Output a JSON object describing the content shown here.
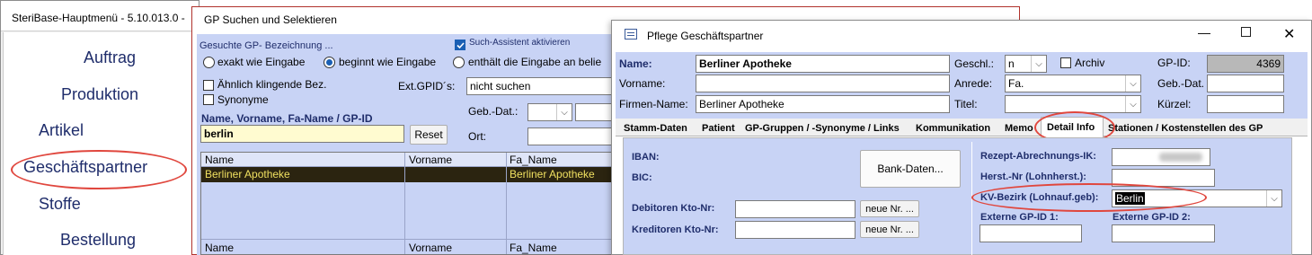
{
  "main_menu": {
    "title": "SteriBase-Hauptmenü  -  5.10.013.0  -",
    "items": [
      "Auftrag",
      "Produktion",
      "Artikel",
      "Geschäftspartner",
      "Stoffe",
      "Bestellung"
    ]
  },
  "search": {
    "title": "GP Suchen und Selektieren",
    "gesuchte_label": "Gesuchte GP- Bezeichnung ...",
    "assistent_label": "Such-Assistent aktivieren",
    "assistent_checked": true,
    "radio_options": [
      "exakt wie Eingabe",
      "beginnt wie Eingabe",
      "enthält die Eingabe an belie"
    ],
    "radio_selected": 1,
    "aehnlich_label": "Ähnlich klingende Bez.",
    "synonyme_label": "Synonyme",
    "ext_gpid_label": "Ext.GPID´s:",
    "ext_gpid_value": "nicht suchen",
    "name_field_label": "Name, Vorname, Fa-Name / GP-ID",
    "name_field_value": "berlin",
    "reset_label": "Reset",
    "gebdat_label": "Geb.-Dat.:",
    "ort_label": "Ort:",
    "columns": [
      "Name",
      "Vorname",
      "Fa_Name"
    ],
    "result_row": {
      "name": "Berliner Apotheke",
      "vorname": "",
      "fa_name": "Berliner Apotheke"
    },
    "footer_columns": [
      "Name",
      "Vorname",
      "Fa_Name"
    ]
  },
  "pflege": {
    "title": "Pflege Geschäftspartner",
    "name_label": "Name:",
    "name_value": "Berliner Apotheke",
    "vorname_label": "Vorname:",
    "vorname_value": "",
    "firmenname_label": "Firmen-Name:",
    "firmenname_value": "Berliner Apotheke",
    "geschl_label": "Geschl.:",
    "geschl_value": "n",
    "archiv_label": "Archiv",
    "anrede_label": "Anrede:",
    "anrede_value": "Fa.",
    "titel_label": "Titel:",
    "gpid_label": "GP-ID:",
    "gpid_value": "4369",
    "gebdat_label": "Geb.-Dat.",
    "kuerzel_label": "Kürzel:",
    "tabs": [
      "Stamm-Daten",
      "Patient",
      "GP-Gruppen / -Synonyme / Links",
      "Kommunikation",
      "Memo",
      "Detail Info",
      "Stationen / Kostenstellen des GP"
    ],
    "active_tab": "Detail Info",
    "iban_label": "IBAN:",
    "bic_label": "BIC:",
    "bankdaten_label": "Bank-Daten...",
    "debitoren_label": "Debitoren Kto-Nr:",
    "kreditoren_label": "Kreditoren Kto-Nr:",
    "neue_nr_label": "neue Nr. ...",
    "rezept_label": "Rezept-Abrechnungs-IK:",
    "herst_label": "Herst.-Nr (Lohnherst.):",
    "kv_label": "KV-Bezirk (Lohnauf.geb):",
    "kv_value": "Berlin",
    "ext_gpid1_label": "Externe GP-ID 1:",
    "ext_gpid2_label": "Externe GP-ID 2:"
  },
  "colors": {
    "panel_blue": "#c8d3f5",
    "navy_text": "#1f2d6b",
    "selected_row_bg": "#2b2410",
    "selected_row_text": "#f0e060",
    "highlight_red": "#e0473e",
    "name_input_bg": "#fffbd0"
  },
  "icons": [
    "checkbox-checked-icon",
    "window-form-icon",
    "minimize-icon",
    "maximize-icon",
    "close-icon",
    "chevron-down-icon"
  ]
}
